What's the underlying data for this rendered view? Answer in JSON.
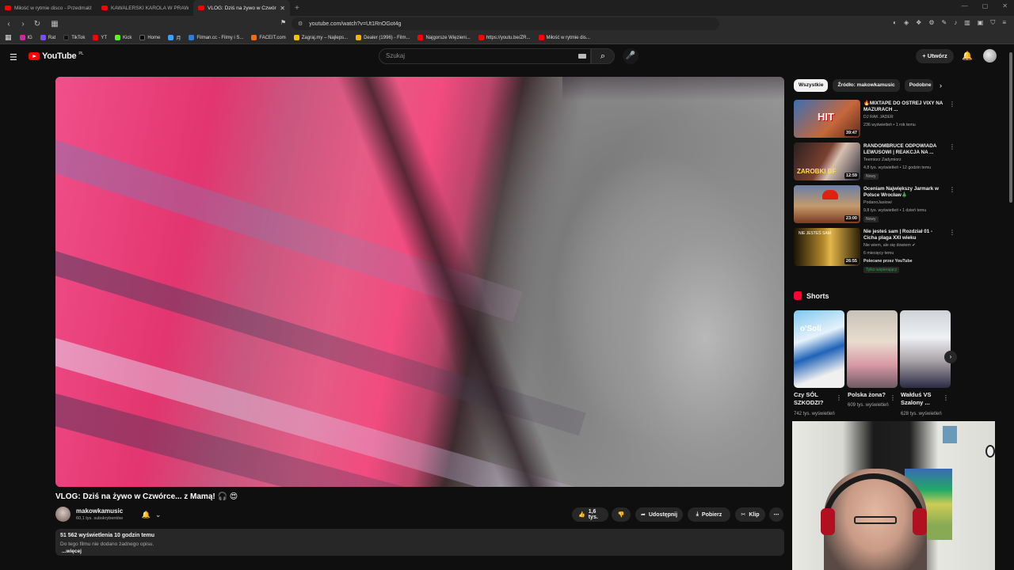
{
  "browser": {
    "tabs": [
      {
        "title": "Miłość w rytmie disco - Przedmałżeńsk",
        "active": false
      },
      {
        "title": "KAWALERSKI KAROLA W PRAWDZIWY",
        "active": false
      },
      {
        "title": "VLOG: Dziś na żywo w Czwórce",
        "active": true
      }
    ],
    "new_tab": "+",
    "url": "youtube.com/watch?v=Ut1RnOGot4g",
    "bookmarks": [
      "IG",
      "Rat",
      "TikTok",
      "YT",
      "Kick",
      "Home",
      "月",
      "Filman.cc - Filmy i S...",
      "FACEIT.com",
      "Zagraj.my – Najleps...",
      "Dealer (1996) - Film...",
      "Najgorsze Więzieni...",
      "https://youtu.be/ZR...",
      "Miłość w rytmie dis..."
    ]
  },
  "youtube": {
    "logo": "YouTube",
    "logo_region": "PL",
    "search_placeholder": "Szukaj",
    "create_label": "Utwórz"
  },
  "video": {
    "title": "VLOG: Dziś na żywo w Czwórce... z Mamą! 🎧 😍",
    "channel": "makowkamusic",
    "subscribers": "60,1 tys. subskrybentów",
    "likes": "1,6 tys.",
    "share": "Udostępnij",
    "download": "Pobierz",
    "clip": "Klip",
    "views_line": "51 562 wyświetlenia  10 godzin temu",
    "description": "Do tego filmu nie dodano żadnego opisu.",
    "more": "...więcej"
  },
  "sidebar": {
    "chips": [
      "Wszystkie",
      "Źródło: makowkamusic",
      "Podobne"
    ],
    "recommendations": [
      {
        "title": "🔥MIXTAPE DO OSTREJ VIXY NA MAZURACH ...",
        "channel": "DJ RAK JADER",
        "meta": "236 wyświetleń • 1 rok temu",
        "duration": "39:47",
        "badge": ""
      },
      {
        "title": "RANDOMBRUCE ODPOWIADA LEWUSOWI | REAKCJA NA ...",
        "channel": "Teemiorz Zadymiorz",
        "meta": "4,8 tys. wyświetleń • 12 godzin temu",
        "duration": "12:59",
        "badge": "Nowy"
      },
      {
        "title": "Oceniam Największy Jarmark w Polsce Wrocław🎄",
        "channel": "PodanoJasiowi",
        "meta": "9,8 tys. wyświetleń • 1 dzień temu",
        "duration": "23:00",
        "badge": "Nowy"
      },
      {
        "title": "Nie jesteś sam | Rozdział 01 - Cicha plaga XXI wieku",
        "channel": "Nie wiem, ale się dowiem ✔",
        "meta": "6 miesięcy temu",
        "extra": "Polecane przez YouTube",
        "duration": "26:55",
        "badge": "Tylko wspierający"
      }
    ],
    "shorts_heading": "Shorts",
    "shorts": [
      {
        "title": "Czy SÓL SZKODZI?",
        "views": "742 tys. wyświetleń"
      },
      {
        "title": "Polska żona?",
        "views": "609 tys. wyświetleń"
      },
      {
        "title": "Wałduś VS Szalony ...",
        "views": "628 tys. wyświetleń"
      }
    ]
  },
  "icons": {
    "back": "back-arrow-icon",
    "forward": "forward-arrow-icon",
    "reload": "reload-icon",
    "menu": "hamburger-menu-icon",
    "search": "search-icon",
    "mic": "microphone-icon",
    "bell": "bell-icon",
    "like": "thumbs-up-icon",
    "dislike": "thumbs-down-icon",
    "share": "share-icon",
    "download": "download-icon",
    "clip": "scissors-icon"
  },
  "colors": {
    "accent": "#ff0000",
    "background": "#0f0f0f",
    "pill": "#272727"
  }
}
